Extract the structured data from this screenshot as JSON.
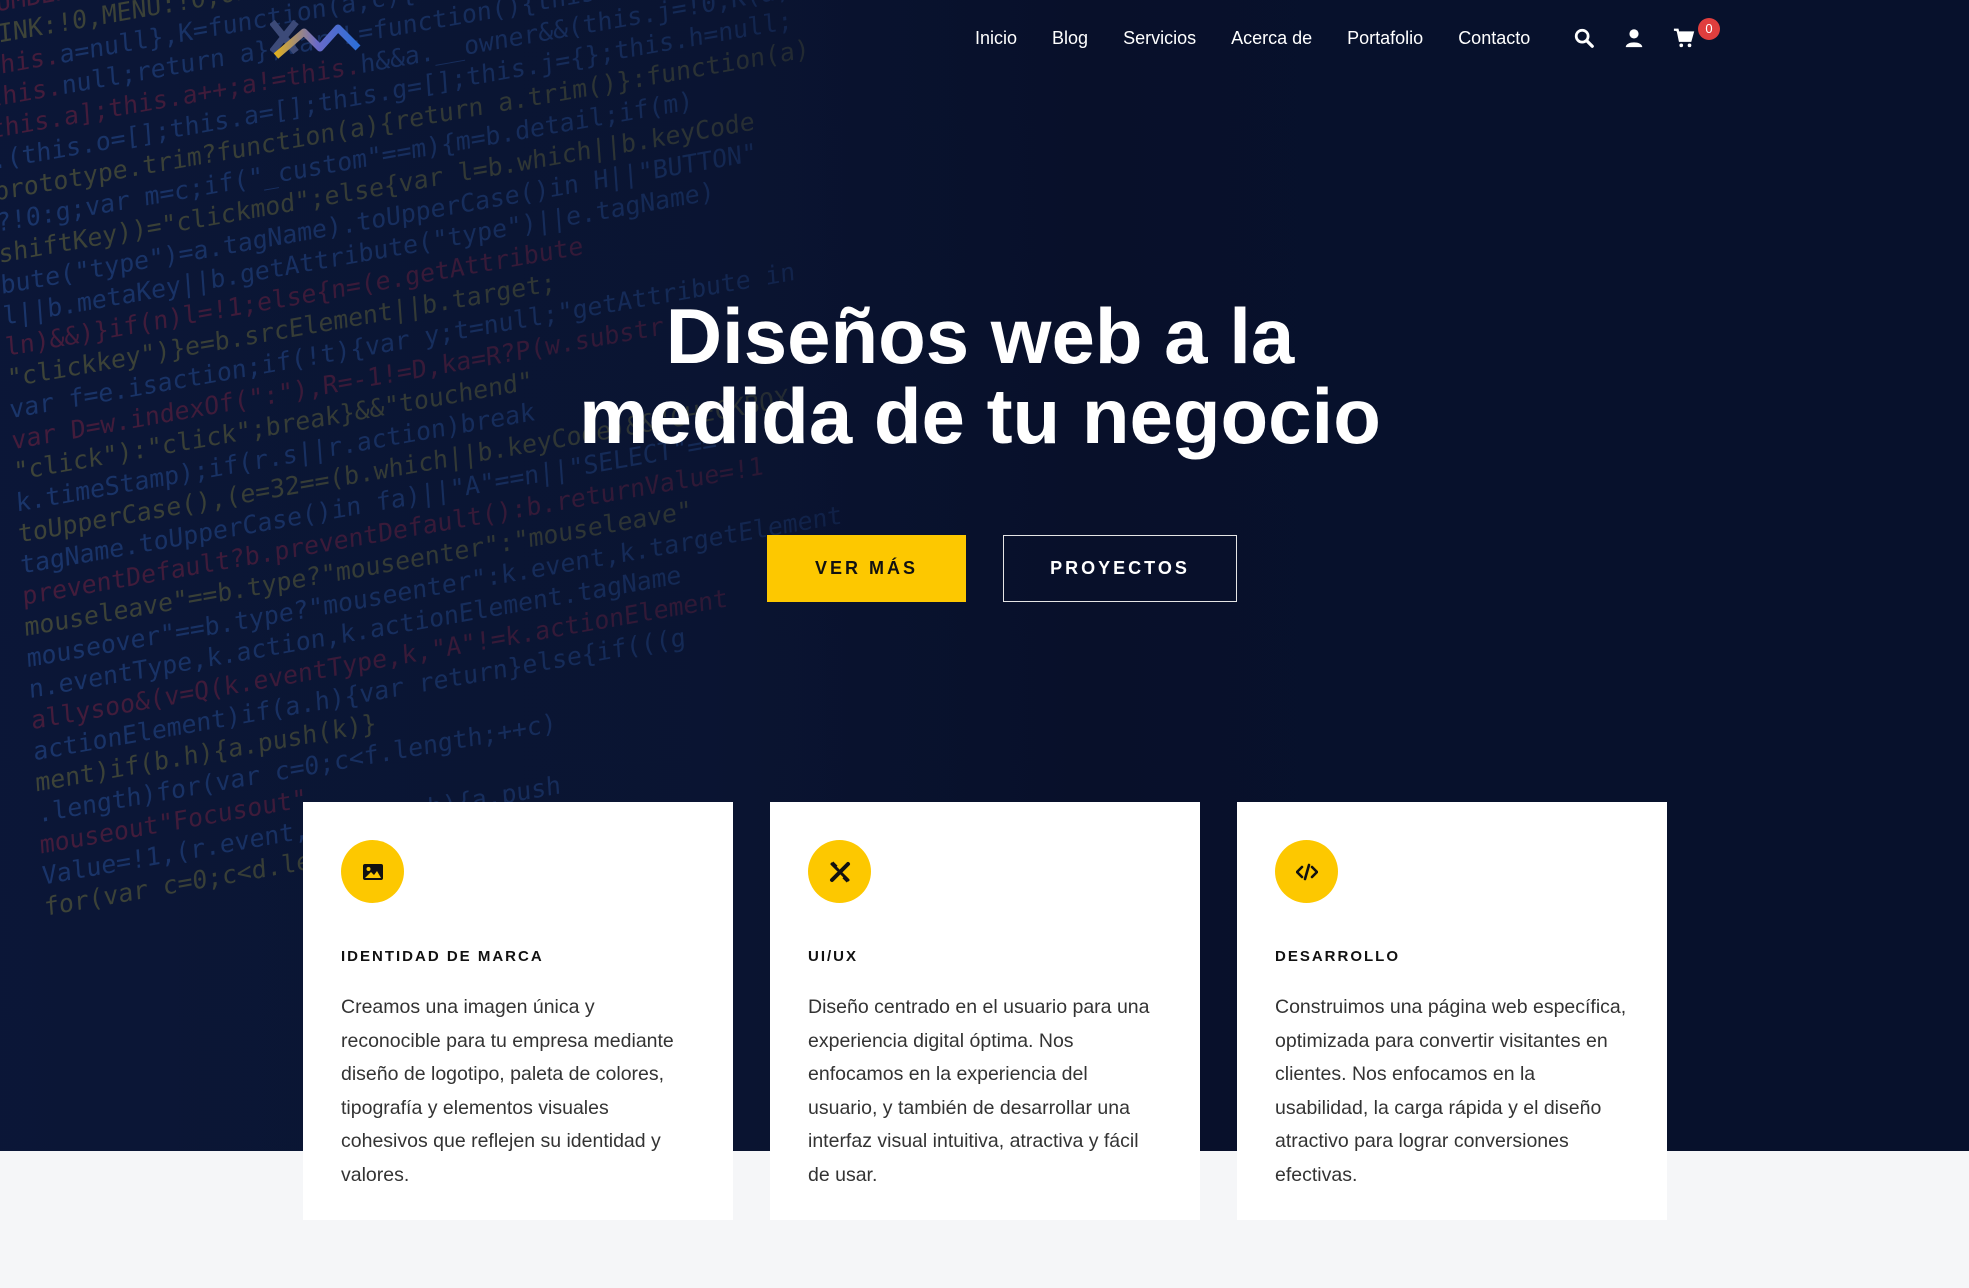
{
  "brand": {
    "logo_icon": "xw-logo-icon",
    "colors": {
      "accent": "#fdc800",
      "hero_bg": "#07112c",
      "badge": "#e03e3e"
    }
  },
  "nav": {
    "items": [
      {
        "label": "Inicio"
      },
      {
        "label": "Blog"
      },
      {
        "label": "Servicios"
      },
      {
        "label": "Acerca de"
      },
      {
        "label": "Portafolio"
      },
      {
        "label": "Contacto"
      }
    ],
    "icons": [
      "search-icon",
      "user-icon",
      "cart-icon"
    ],
    "cart_count": "0"
  },
  "hero": {
    "title_line1": "Diseños web a la",
    "title_line2": "medida de tu negocio",
    "primary_button": "VER MÁS",
    "secondary_button": "PROYECTOS"
  },
  "services": [
    {
      "icon": "image-icon",
      "title": "IDENTIDAD DE MARCA",
      "text": "Creamos una imagen única y reconocible para tu empresa mediante diseño de logotipo, paleta de colores, tipografía y elementos visuales cohesivos que reflejen su identidad y valores."
    },
    {
      "icon": "design-tools-icon",
      "title": "UI/UX",
      "text": "Diseño centrado en el usuario para una experiencia digital óptima. Nos enfocamos en la experiencia del usuario, y también de desarrollar una interfaz visual intuitiva, atractiva y fácil de usar."
    },
    {
      "icon": "code-icon",
      "title": "DESARROLLO",
      "text": "Construimos una página web específica, optimizada para convertir visitantes en clientes. Nos enfocamos en la usabilidad, la carga rápida y el diseño atractivo para lograr conversiones efectivas."
    }
  ]
}
